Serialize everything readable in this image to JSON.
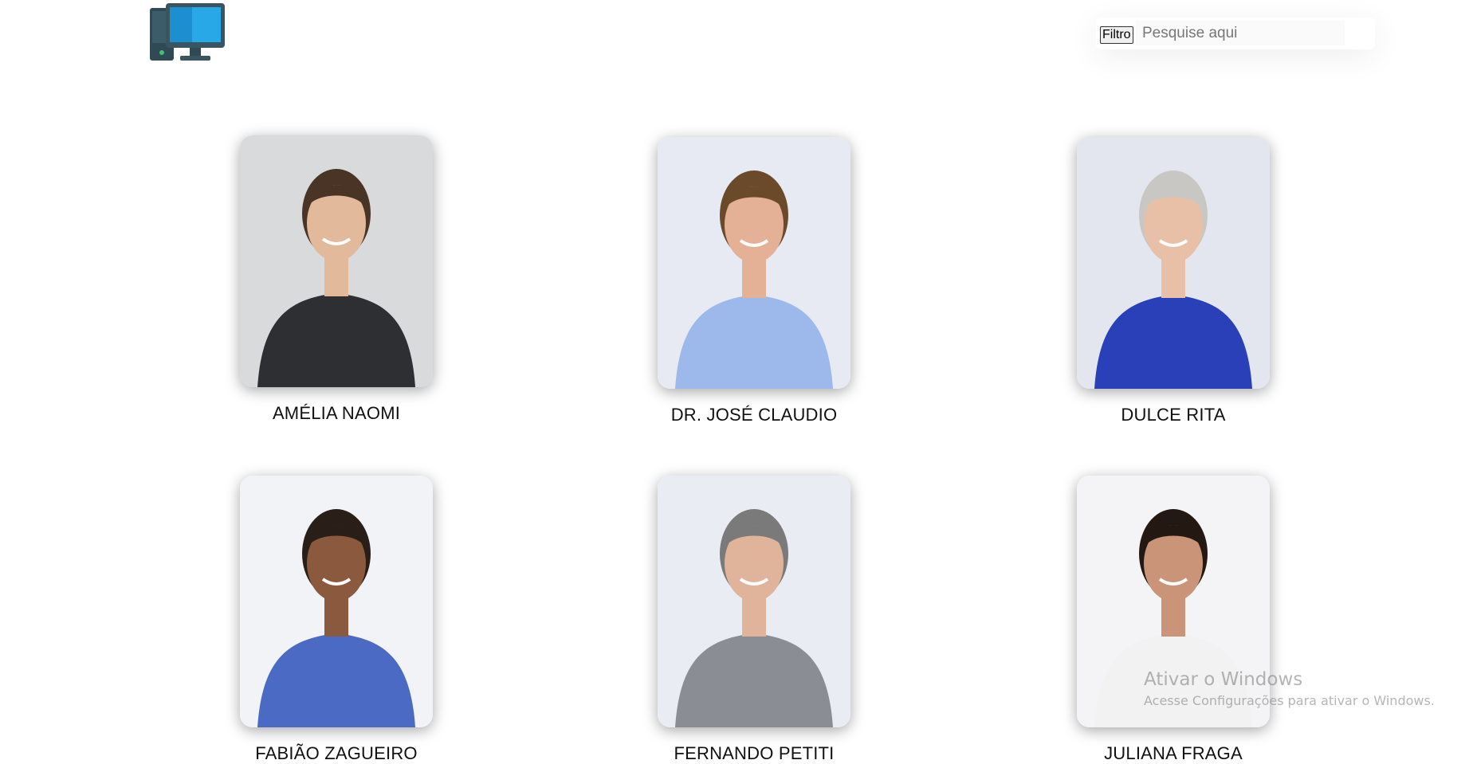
{
  "header": {
    "logo_icon": "desktop-computer-icon",
    "filter_button_label": "Filtro",
    "search_placeholder": "Pesquise aqui"
  },
  "people": [
    {
      "name": "AMÉLIA NAOMI",
      "bg": "#d9dadc",
      "shirt": "#2d2f33",
      "hair": "#4a3426",
      "skin": "#e2b99a"
    },
    {
      "name": "DR. JOSÉ CLAUDIO",
      "bg": "#e8eaf3",
      "shirt": "#9db8ea",
      "hair": "#6b4a2b",
      "skin": "#e5b196"
    },
    {
      "name": "DULCE RITA",
      "bg": "#e4e6ef",
      "shirt": "#2940b8",
      "hair": "#c9c7c4",
      "skin": "#e8c0a8"
    },
    {
      "name": "FABIÃO ZAGUEIRO",
      "bg": "#f2f3f7",
      "shirt": "#4a6ac4",
      "hair": "#2a1e18",
      "skin": "#8b5a3e"
    },
    {
      "name": "FERNANDO PETITI",
      "bg": "#eaecf3",
      "shirt": "#8a8d94",
      "hair": "#7a7a7a",
      "skin": "#e0b49a"
    },
    {
      "name": "JULIANA FRAGA",
      "bg": "#f4f4f6",
      "shirt": "#f2f2f2",
      "hair": "#241812",
      "skin": "#c99478"
    }
  ],
  "watermark": {
    "title": "Ativar o Windows",
    "subtitle": "Acesse Configurações para ativar o Windows."
  }
}
